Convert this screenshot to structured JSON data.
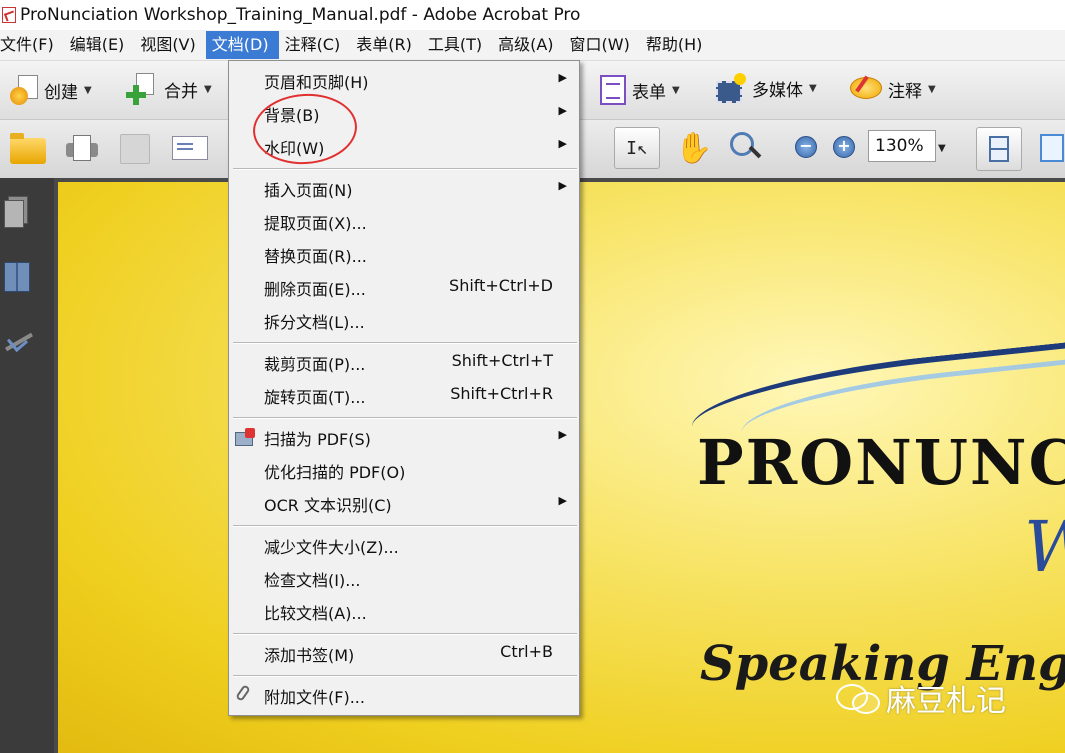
{
  "window": {
    "title": "ProNunciation Workshop_Training_Manual.pdf - Adobe Acrobat Pro"
  },
  "menubar": {
    "items": [
      "文件(F)",
      "编辑(E)",
      "视图(V)",
      "文档(D)",
      "注释(C)",
      "表单(R)",
      "工具(T)",
      "高级(A)",
      "窗口(W)",
      "帮助(H)"
    ],
    "active": "文档(D)"
  },
  "toolbar": {
    "create_label": "创建",
    "merge_label": "合并",
    "forms_label": "表单",
    "multimedia_label": "多媒体",
    "comment_label": "注释",
    "zoom_value": "130%"
  },
  "document_menu": {
    "items": [
      {
        "label": "页眉和页脚(H)",
        "shortcut": "",
        "submenu": true
      },
      {
        "label": "背景(B)",
        "shortcut": "",
        "submenu": true
      },
      {
        "label": "水印(W)",
        "shortcut": "",
        "submenu": true
      },
      {
        "label": "插入页面(N)",
        "shortcut": "",
        "submenu": true
      },
      {
        "label": "提取页面(X)...",
        "shortcut": "",
        "submenu": false
      },
      {
        "label": "替换页面(R)...",
        "shortcut": "",
        "submenu": false
      },
      {
        "label": "删除页面(E)...",
        "shortcut": "Shift+Ctrl+D",
        "submenu": false
      },
      {
        "label": "拆分文档(L)...",
        "shortcut": "",
        "submenu": false
      },
      {
        "label": "裁剪页面(P)...",
        "shortcut": "Shift+Ctrl+T",
        "submenu": false
      },
      {
        "label": "旋转页面(T)...",
        "shortcut": "Shift+Ctrl+R",
        "submenu": false
      },
      {
        "label": "扫描为 PDF(S)",
        "shortcut": "",
        "submenu": true
      },
      {
        "label": "优化扫描的 PDF(O)",
        "shortcut": "",
        "submenu": false
      },
      {
        "label": "OCR 文本识别(C)",
        "shortcut": "",
        "submenu": true
      },
      {
        "label": "减少文件大小(Z)...",
        "shortcut": "",
        "submenu": false
      },
      {
        "label": "检查文档(I)...",
        "shortcut": "",
        "submenu": false
      },
      {
        "label": "比较文档(A)...",
        "shortcut": "",
        "submenu": false
      },
      {
        "label": "添加书签(M)",
        "shortcut": "Ctrl+B",
        "submenu": false
      },
      {
        "label": "附加文件(F)...",
        "shortcut": "",
        "submenu": false
      }
    ]
  },
  "pdf_page": {
    "title": "PRONUNC",
    "title_fragment": "W",
    "subtitle": "Speaking Engli"
  },
  "watermark": {
    "text": "麻豆札记"
  },
  "colors": {
    "menu_active": "#3b7bd4",
    "highlight_circle": "#e03030",
    "page_yellow": "#efcf1f"
  }
}
